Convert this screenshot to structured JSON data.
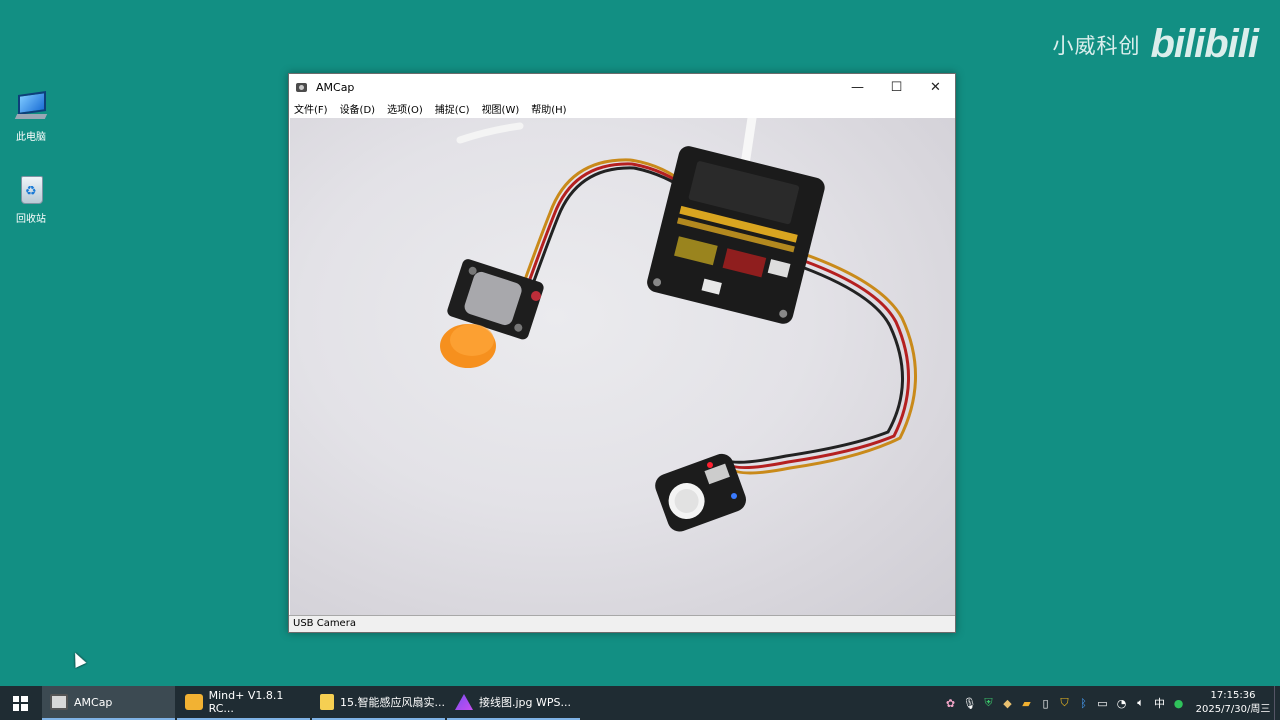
{
  "desktop": {
    "icons": [
      {
        "label": "此电脑",
        "icon": "computer-icon"
      },
      {
        "label": "回收站",
        "icon": "recycle-bin-icon"
      }
    ],
    "watermark": {
      "brand_cn": "小威科创",
      "brand_logo": "bilibili"
    }
  },
  "window": {
    "title": "AMCap",
    "controls": {
      "minimize": "—",
      "maximize": "☐",
      "close": "✕"
    },
    "menu": [
      "文件(F)",
      "设备(D)",
      "选项(O)",
      "捕捉(C)",
      "视图(W)",
      "帮助(H)"
    ],
    "status": "USB Camera"
  },
  "taskbar": {
    "items": [
      {
        "label": "AMCap",
        "active": true
      },
      {
        "label": "Mind+ V1.8.1 RC...",
        "active": false
      },
      {
        "label": "15.智能感应风扇实...",
        "active": false
      },
      {
        "label": "接线图.jpg  WPS...",
        "active": false
      }
    ],
    "ime": "中",
    "time": "17:15:36",
    "date": "2025/7/30/周三"
  },
  "colors": {
    "desktop": "#128f83",
    "taskbar": "#1f2c33",
    "accent": "#7fb3e6"
  }
}
